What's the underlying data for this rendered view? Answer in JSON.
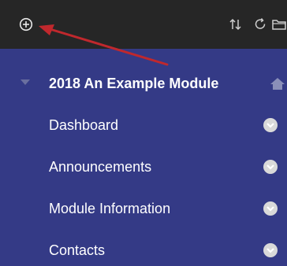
{
  "toolbar": {
    "background": "#262626",
    "icons": {
      "add": "add-circle-icon",
      "reorder": "reorder-arrows-icon",
      "refresh": "refresh-icon",
      "folder": "folder-icon"
    }
  },
  "menu": {
    "background": "#343a86",
    "module": {
      "title": "2018 An Example Module",
      "expanded": true
    },
    "items": [
      {
        "label": "Dashboard"
      },
      {
        "label": "Announcements"
      },
      {
        "label": "Module Information"
      },
      {
        "label": "Contacts"
      }
    ]
  },
  "annotation": {
    "type": "red-arrow",
    "color": "#c0282d",
    "points_to": "add-circle-icon"
  }
}
